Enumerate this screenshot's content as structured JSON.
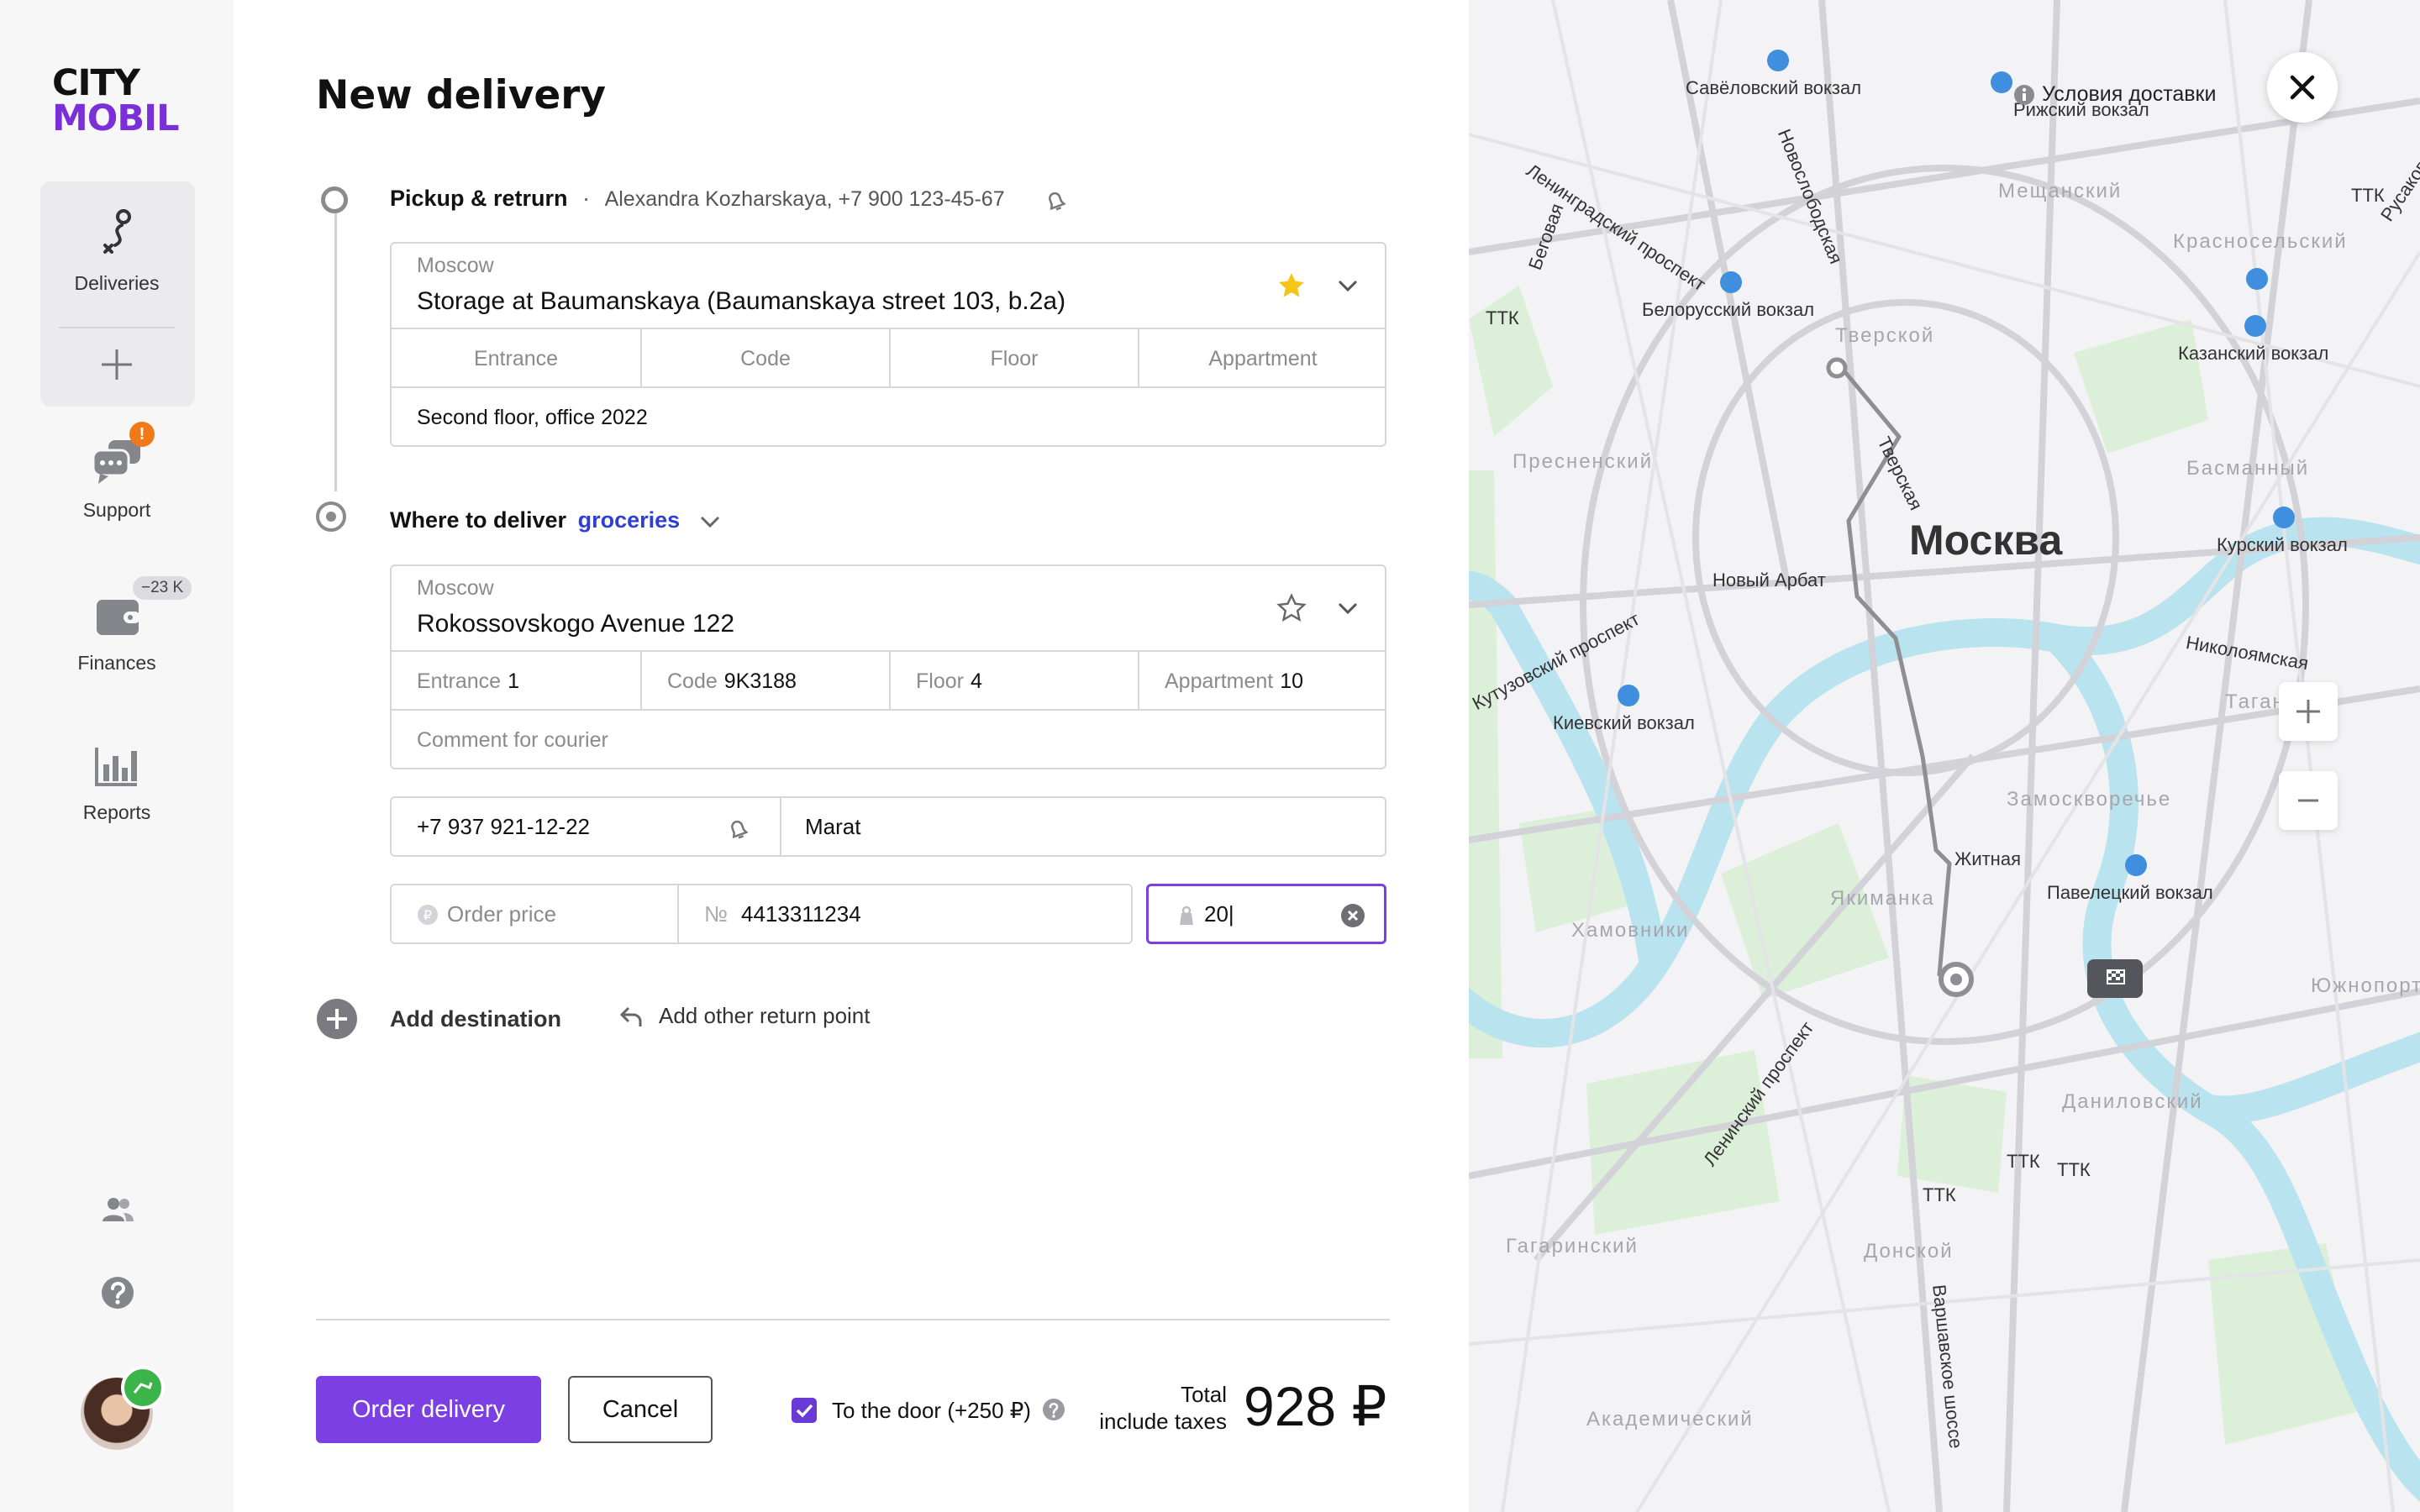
{
  "brand": {
    "line1": "CITY",
    "line2": "MOBIL"
  },
  "sidebar": {
    "deliveries_label": "Deliveries",
    "support_label": "Support",
    "support_badge": "!",
    "finances_label": "Finances",
    "finances_badge": "−23 K",
    "reports_label": "Reports"
  },
  "form": {
    "title": "New delivery",
    "pickup": {
      "heading": "Pickup & retrurn",
      "separator": "·",
      "contact": "Alexandra Kozharskaya, +7 900 123-45-67",
      "city": "Moscow",
      "address": "Storage at Baumanskaya (Baumanskaya street 103, b.2a)",
      "entrance_label": "Entrance",
      "code_label": "Code",
      "floor_label": "Floor",
      "apartment_label": "Appartment",
      "comment": "Second floor, office 2022"
    },
    "destination": {
      "heading": "Where to deliver",
      "category": "groceries",
      "city": "Moscow",
      "address": "Rokossovskogo Avenue 122",
      "entrance_label": "Entrance",
      "entrance_value": "1",
      "code_label": "Code",
      "code_value": "9K3188",
      "floor_label": "Floor",
      "floor_value": "4",
      "apartment_label": "Appartment",
      "apartment_value": "10",
      "comment_placeholder": "Comment for courier",
      "phone": "+7 937 921-12-22",
      "name": "Marat",
      "price_placeholder": "Order price",
      "order_no_prefix": "№",
      "order_no": "4413311234",
      "weight": "20|"
    },
    "add_destination": "Add destination",
    "add_return": "Add other return point",
    "order_button": "Order delivery",
    "cancel_button": "Cancel",
    "to_door": "To the door (+250 ₽)",
    "total_line1": "Total",
    "total_line2": "include taxes",
    "total_value": "928 ₽"
  },
  "map": {
    "city": "Москва",
    "terms": "Условия доставки",
    "stations": [
      "Савёловский вокзал",
      "Рижский вокзал",
      "Белорусский вокзал",
      "Казанский вокзал",
      "Курский вокзал",
      "Киевский вокзал",
      "Павелецкий вокзал"
    ],
    "districts": [
      "Мещанский",
      "Красносельский",
      "Тверской",
      "Пресненский",
      "Басманный",
      "Таганский",
      "Замоскворечье",
      "Якиманка",
      "Хамовники",
      "Даниловский",
      "Донской",
      "Гагаринский",
      "Академический",
      "Южнопортовый"
    ],
    "streets": [
      "Ленинградский проспект",
      "Новослободская",
      "Беговая",
      "Новый Арбат",
      "Кутузовский проспект",
      "Николоямская",
      "Ленинский проспект",
      "Варшавское шоссе",
      "Житная",
      "Тверская",
      "Русаковская"
    ],
    "ttk": "ТТК",
    "colors": {
      "route": "#8e8e94",
      "water": "#b9e3ee",
      "park": "#d9efd7",
      "accent": "#7b3fe4",
      "station": "#3f8fde"
    }
  }
}
